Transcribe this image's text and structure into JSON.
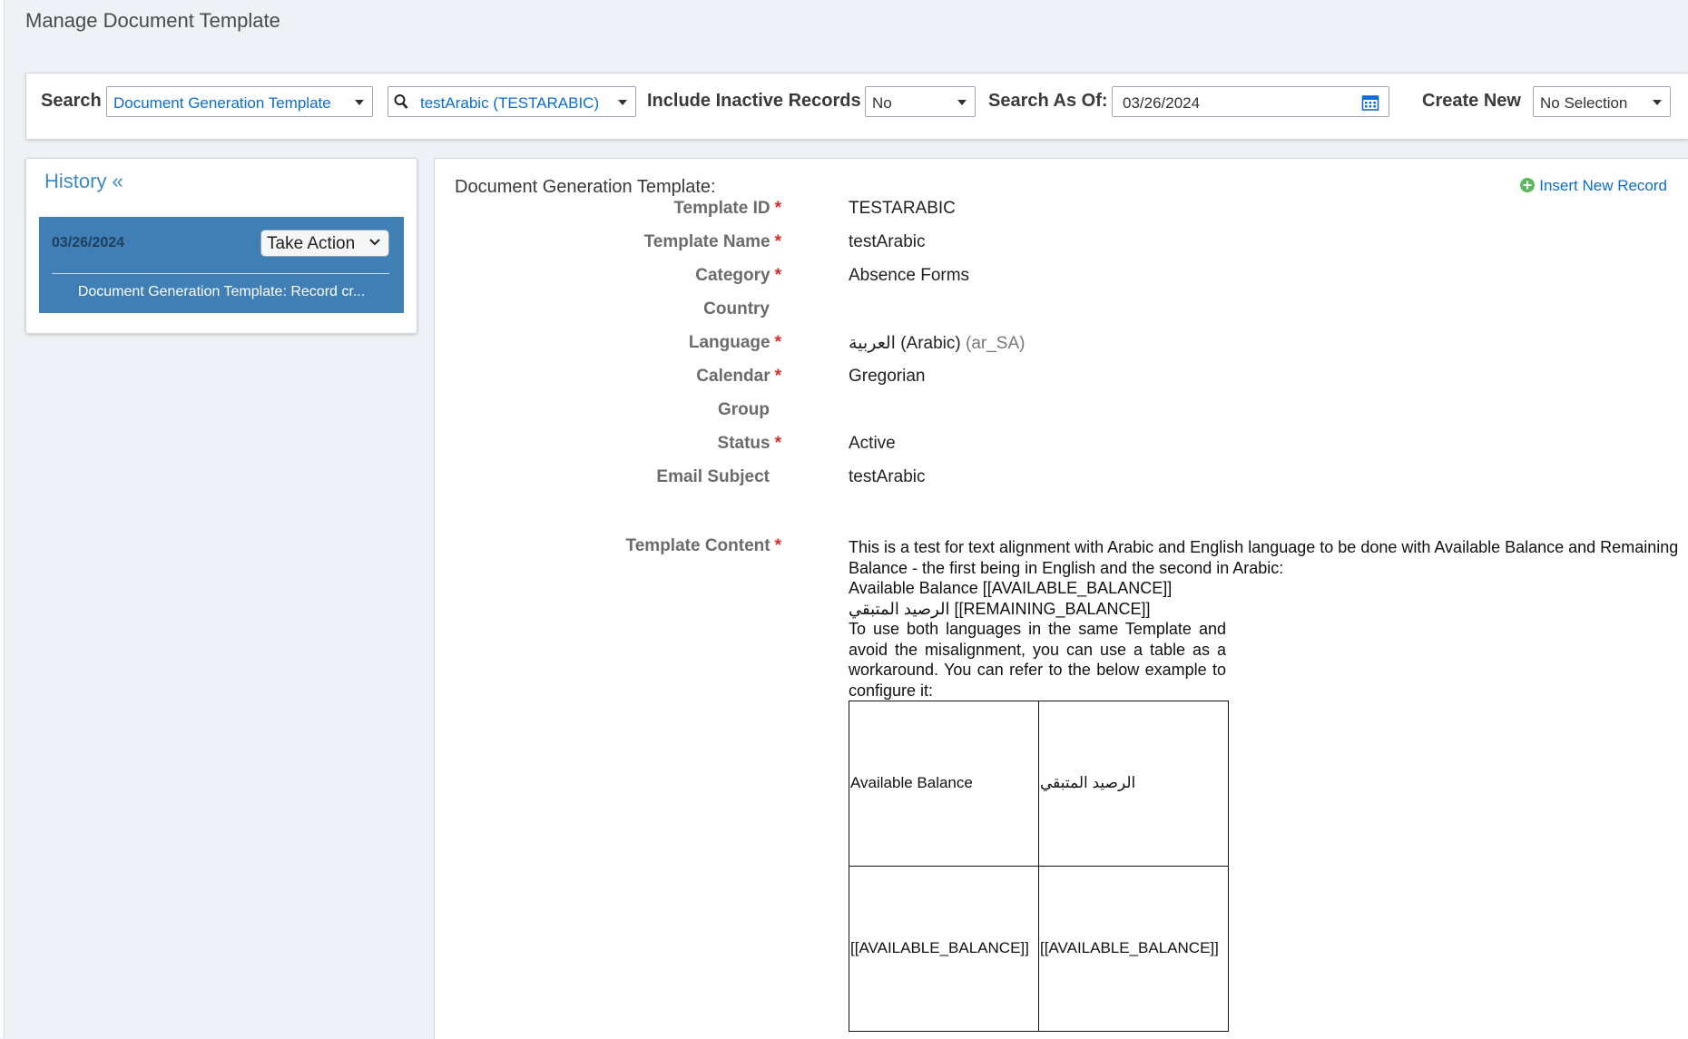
{
  "page": {
    "title": "Manage Document Template"
  },
  "search_bar": {
    "search_label": "Search",
    "search_type": "Document Generation Template",
    "search_query": "testArabic (TESTARABIC)",
    "include_inactive_label": "Include Inactive Records",
    "include_inactive_value": "No",
    "search_as_of_label": "Search As Of:",
    "search_as_of_value": "03/26/2024",
    "create_new_label": "Create New",
    "create_new_value": "No Selection"
  },
  "history": {
    "title": "History «",
    "entries": [
      {
        "date": "03/26/2024",
        "action_label": "Take Action",
        "description": "Document Generation Template: Record cr..."
      }
    ]
  },
  "main": {
    "heading": "Document Generation Template:",
    "insert_link": "Insert New Record",
    "fields": {
      "template_id": {
        "label": "Template ID",
        "value": "TESTARABIC"
      },
      "template_name": {
        "label": "Template Name",
        "value": "testArabic"
      },
      "category": {
        "label": "Category",
        "value": "Absence Forms"
      },
      "country": {
        "label": "Country",
        "value": ""
      },
      "language": {
        "label": "Language",
        "value": "العربية (Arabic)",
        "locale": "(ar_SA)"
      },
      "calendar": {
        "label": "Calendar",
        "value": "Gregorian"
      },
      "group": {
        "label": "Group",
        "value": ""
      },
      "status": {
        "label": "Status",
        "value": "Active"
      },
      "email_subject": {
        "label": "Email Subject",
        "value": "testArabic"
      },
      "template_content": {
        "label": "Template Content"
      }
    },
    "required_marker": "*",
    "content": {
      "line1": "This is a test for text alignment with Arabic and English language to be done with Available Balance and Remaining Balance - the first being in English and the second in Arabic:",
      "line2": "Available Balance [[AVAILABLE_BALANCE]]",
      "line3": "الرصيد المتبقي [[REMAINING_BALANCE]]",
      "line4": "To use both languages in the same Template and avoid the misalignment, you can use a table as a workaround. You can refer to the below example to configure it:",
      "table": {
        "r1c1": "Available Balance",
        "r1c2": "الرصيد المتبقي",
        "r2c1": "[[AVAILABLE_BALANCE]]",
        "r2c2": "[[AVAILABLE_BALANCE]]"
      }
    }
  },
  "colors": {
    "accent": "#0a6ed1",
    "history_card": "#3f7fb5",
    "required": "#d92b2b"
  }
}
